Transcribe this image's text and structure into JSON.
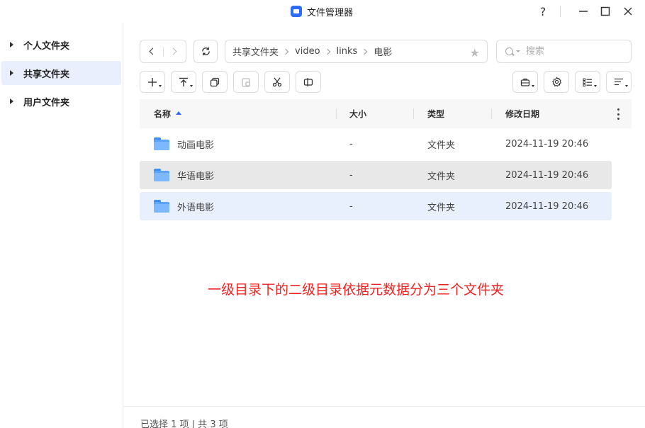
{
  "window": {
    "title": "文件管理器",
    "help_label": "?",
    "minimize_label": "—",
    "maximize_label": "☐",
    "close_label": "✕"
  },
  "sidebar": {
    "items": [
      {
        "label": "个人文件夹",
        "active": false
      },
      {
        "label": "共享文件夹",
        "active": true
      },
      {
        "label": "用户文件夹",
        "active": false
      }
    ]
  },
  "breadcrumb": {
    "items": [
      "共享文件夹",
      "video",
      "links",
      "电影"
    ]
  },
  "search": {
    "placeholder": "搜索",
    "value": ""
  },
  "table": {
    "columns": {
      "name": "名称",
      "size": "大小",
      "type": "类型",
      "modified": "修改日期"
    },
    "sort": {
      "column": "name",
      "direction": "ascending"
    },
    "rows": [
      {
        "name": "动画电影",
        "size": "-",
        "type": "文件夹",
        "modified": "2024-11-19 20:46",
        "state": "normal"
      },
      {
        "name": "华语电影",
        "size": "-",
        "type": "文件夹",
        "modified": "2024-11-19 20:46",
        "state": "hover"
      },
      {
        "name": "外语电影",
        "size": "-",
        "type": "文件夹",
        "modified": "2024-11-19 20:46",
        "state": "selected"
      }
    ]
  },
  "annotation": {
    "text": "一级目录下的二级目录依据元数据分为三个文件夹",
    "color": "#ee2222"
  },
  "status": {
    "text": "已选择 1 项 | 共 3 项"
  },
  "colors": {
    "accent": "#2f6bff",
    "selected_row": "#e9f0fd",
    "hover_row": "#e8e8e8",
    "folder": "#5aa3ff"
  }
}
